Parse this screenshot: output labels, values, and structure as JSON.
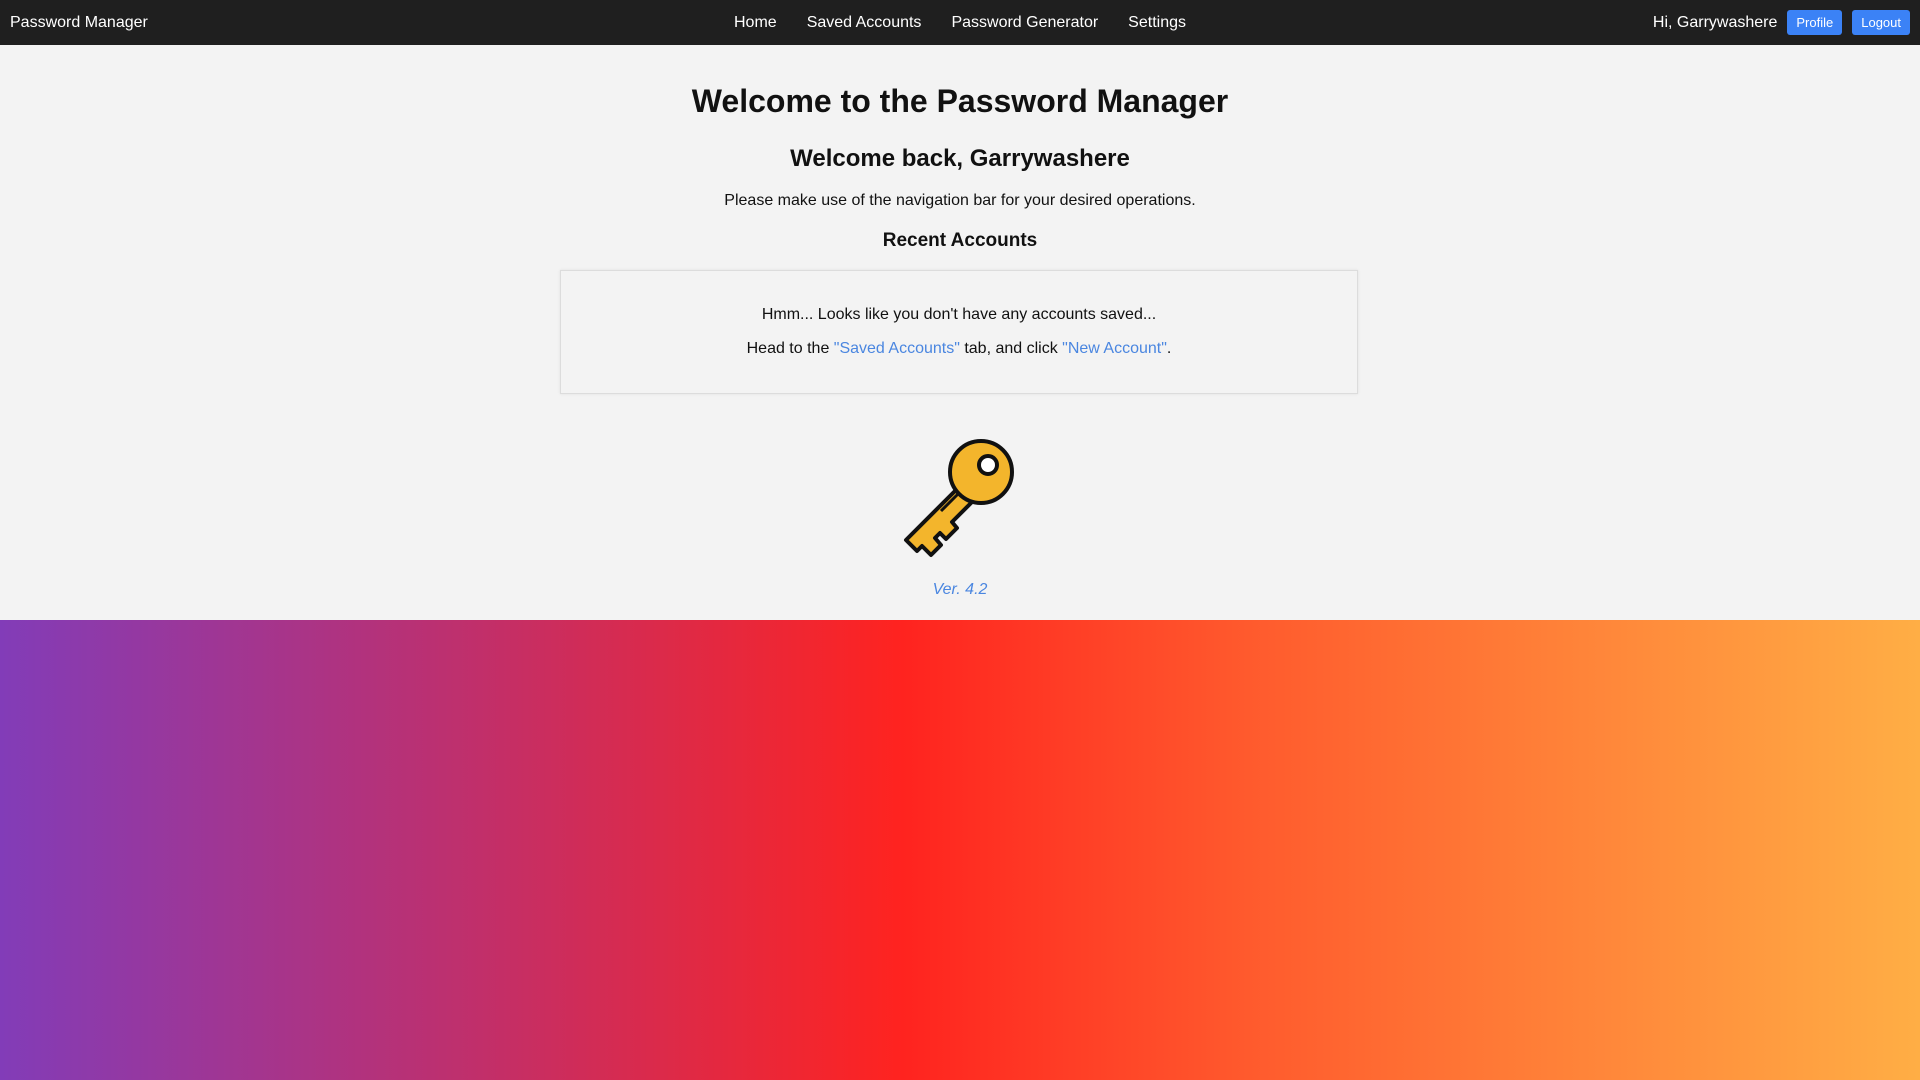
{
  "navbar": {
    "brand": "Password Manager",
    "links": [
      "Home",
      "Saved Accounts",
      "Password Generator",
      "Settings"
    ],
    "greeting": "Hi, Garrywashere",
    "profile_label": "Profile",
    "logout_label": "Logout"
  },
  "main": {
    "title": "Welcome to the Password Manager",
    "subtitle": "Welcome back, Garrywashere",
    "intro": "Please make use of the navigation bar for your desired operations.",
    "recent_heading": "Recent Accounts",
    "empty_message": "Hmm... Looks like you don't have any accounts saved...",
    "hint_prefix": "Head to the ",
    "hint_link1": "\"Saved Accounts\"",
    "hint_middle": " tab, and click ",
    "hint_link2": "\"New Account\"",
    "hint_suffix": ".",
    "version": "Ver. 4.2"
  },
  "colors": {
    "navbar_bg": "#1f1f1f",
    "panel_bg": "#f3f3f3",
    "accent_blue": "#3b82f6",
    "link_blue": "#4a86e0",
    "key_gold": "#f3b52c"
  },
  "icons": {
    "logo": "key-icon"
  }
}
